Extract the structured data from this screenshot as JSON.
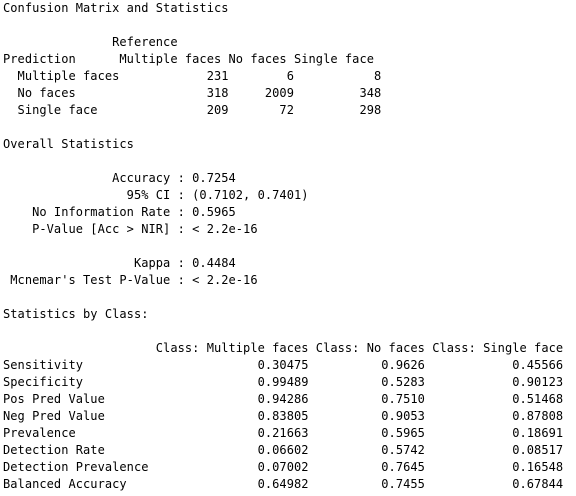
{
  "console": {
    "lines": [
      "Confusion Matrix and Statistics",
      "",
      "               Reference",
      "Prediction      Multiple faces No faces Single face",
      "  Multiple faces            231        6           8",
      "  No faces                  318     2009         348",
      "  Single face               209       72         298",
      "",
      "Overall Statistics",
      "",
      "               Accuracy : 0.7254",
      "                 95% CI : (0.7102, 0.7401)",
      "    No Information Rate : 0.5965",
      "    P-Value [Acc > NIR] : < 2.2e-16",
      "",
      "                  Kappa : 0.4484",
      " Mcnemar's Test P-Value : < 2.2e-16",
      "",
      "Statistics by Class:",
      "",
      "                     Class: Multiple faces Class: No faces Class: Single face",
      "Sensitivity                        0.30475          0.9626            0.45566",
      "Specificity                        0.99489          0.5283            0.90123",
      "Pos Pred Value                     0.94286          0.7510            0.51468",
      "Neg Pred Value                     0.83805          0.9053            0.87808",
      "Prevalence                         0.21663          0.5965            0.18691",
      "Detection Rate                     0.06602          0.5742            0.08517",
      "Detection Prevalence               0.07002          0.7645            0.16548",
      "Balanced Accuracy                  0.64982          0.7455            0.67844"
    ]
  }
}
